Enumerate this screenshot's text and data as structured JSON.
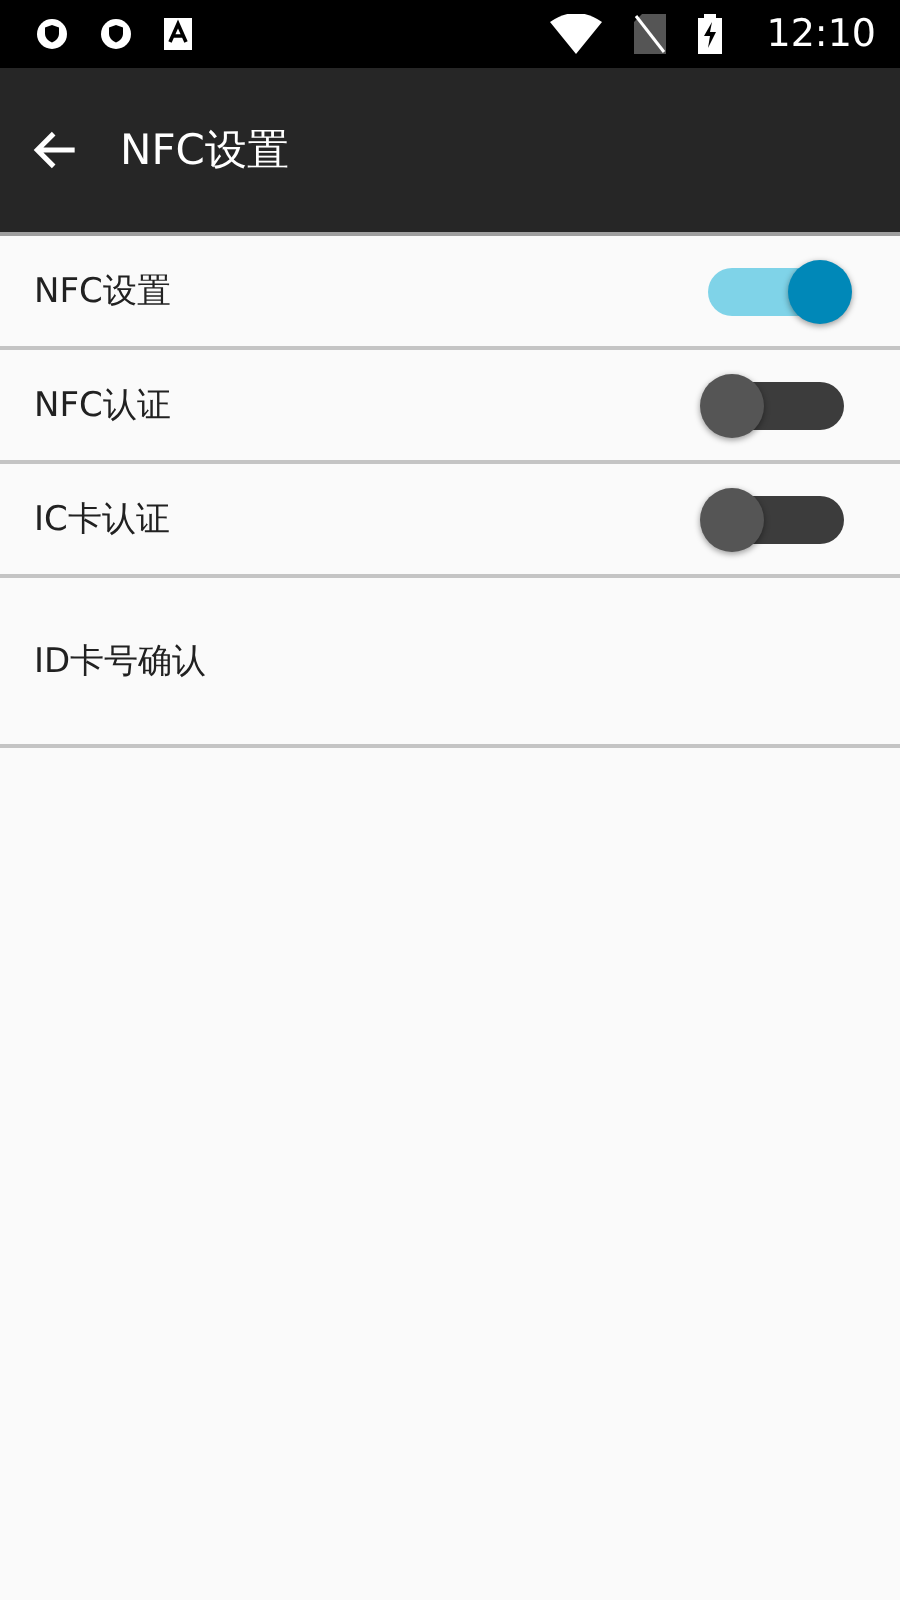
{
  "status_bar": {
    "time": "12:10"
  },
  "toolbar": {
    "title": "NFC设置"
  },
  "settings": [
    {
      "kind": "switch",
      "label": "NFC设置",
      "on": true
    },
    {
      "kind": "switch",
      "label": "NFC认证",
      "on": false
    },
    {
      "kind": "switch",
      "label": "IC卡认证",
      "on": false
    },
    {
      "kind": "link",
      "label": "ID卡号确认"
    }
  ]
}
